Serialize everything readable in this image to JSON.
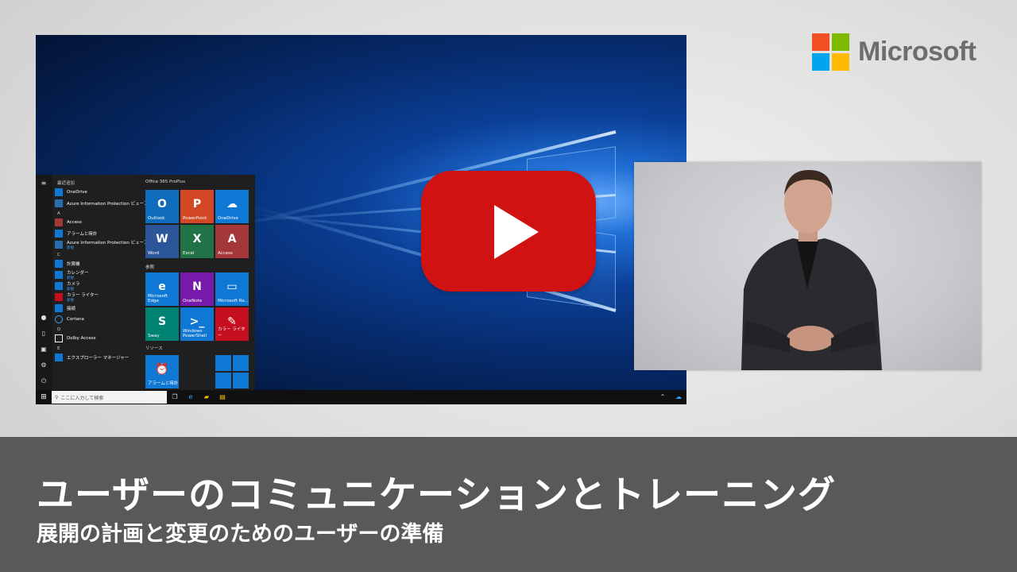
{
  "brand": {
    "name": "Microsoft",
    "colors": [
      "#f25022",
      "#7fba00",
      "#00a4ef",
      "#ffb900"
    ]
  },
  "video": {
    "title": "ユーザーのコミュニケーションとトレーニング",
    "subtitle": "展開の計画と変更のためのユーザーの準備",
    "play_button_color": "#d11212"
  },
  "start_menu": {
    "recent_header": "最近追加",
    "apps": [
      {
        "icon": "onedrive-icon",
        "label": "OneDrive",
        "sub": ""
      },
      {
        "icon": "aip-icon",
        "label": "Azure Information Protection ビューアー",
        "sub": ""
      },
      {
        "section": "A"
      },
      {
        "icon": "access-icon",
        "label": "Access",
        "sub": ""
      },
      {
        "icon": "alarm-icon",
        "label": "アラームと時計",
        "sub": ""
      },
      {
        "icon": "aip-icon",
        "label": "Azure Information Protection ビューアー",
        "sub": "新規"
      },
      {
        "section": "C"
      },
      {
        "icon": "calculator-icon",
        "label": "計算機",
        "sub": ""
      },
      {
        "icon": "calendar-icon",
        "label": "カレンダー",
        "sub": "新規"
      },
      {
        "icon": "camera-icon",
        "label": "カメラ",
        "sub": "新規"
      },
      {
        "icon": "color-writer-icon",
        "label": "カラー ライター",
        "sub": "新規"
      },
      {
        "icon": "connect-icon",
        "label": "接続",
        "sub": ""
      },
      {
        "icon": "cortana-icon",
        "label": "Cortana",
        "sub": ""
      },
      {
        "section": "D"
      },
      {
        "icon": "dolby-icon",
        "label": "Dolby Access",
        "sub": ""
      },
      {
        "section": "E"
      },
      {
        "icon": "explorer-icon",
        "label": "エクスプローラー マネージャー",
        "sub": ""
      }
    ],
    "tile_groups": [
      {
        "header": "Office 365 ProPlus"
      },
      {
        "header": "参照"
      },
      {
        "header": "リソース"
      }
    ],
    "tiles": [
      {
        "label": "Outlook",
        "glyph": "O",
        "color": "#0f6cbd"
      },
      {
        "label": "PowerPoint",
        "glyph": "P",
        "color": "#d24726"
      },
      {
        "label": "OneDrive",
        "glyph": "☁",
        "color": "#0f78d4"
      },
      {
        "label": "Word",
        "glyph": "W",
        "color": "#2b579a"
      },
      {
        "label": "Excel",
        "glyph": "X",
        "color": "#217346"
      },
      {
        "label": "Access",
        "glyph": "A",
        "color": "#a4373a"
      },
      {
        "label": "Microsoft Edge",
        "glyph": "e",
        "color": "#0f78d4"
      },
      {
        "label": "OneNote",
        "glyph": "N",
        "color": "#7719aa"
      },
      {
        "label": "Microsoft Re...",
        "glyph": "▭",
        "color": "#0f78d4"
      },
      {
        "label": "Sway",
        "glyph": "S",
        "color": "#008272"
      },
      {
        "label": "Windows PowerShell",
        "glyph": ">_",
        "color": "#0f78d4"
      },
      {
        "label": "カラー ライター",
        "glyph": "✎",
        "color": "#c50f1f"
      },
      {
        "label": "アラームと時計",
        "glyph": "⏰",
        "color": "#0f78d4"
      }
    ]
  },
  "taskbar": {
    "search_placeholder": "ここに入力して検索"
  }
}
